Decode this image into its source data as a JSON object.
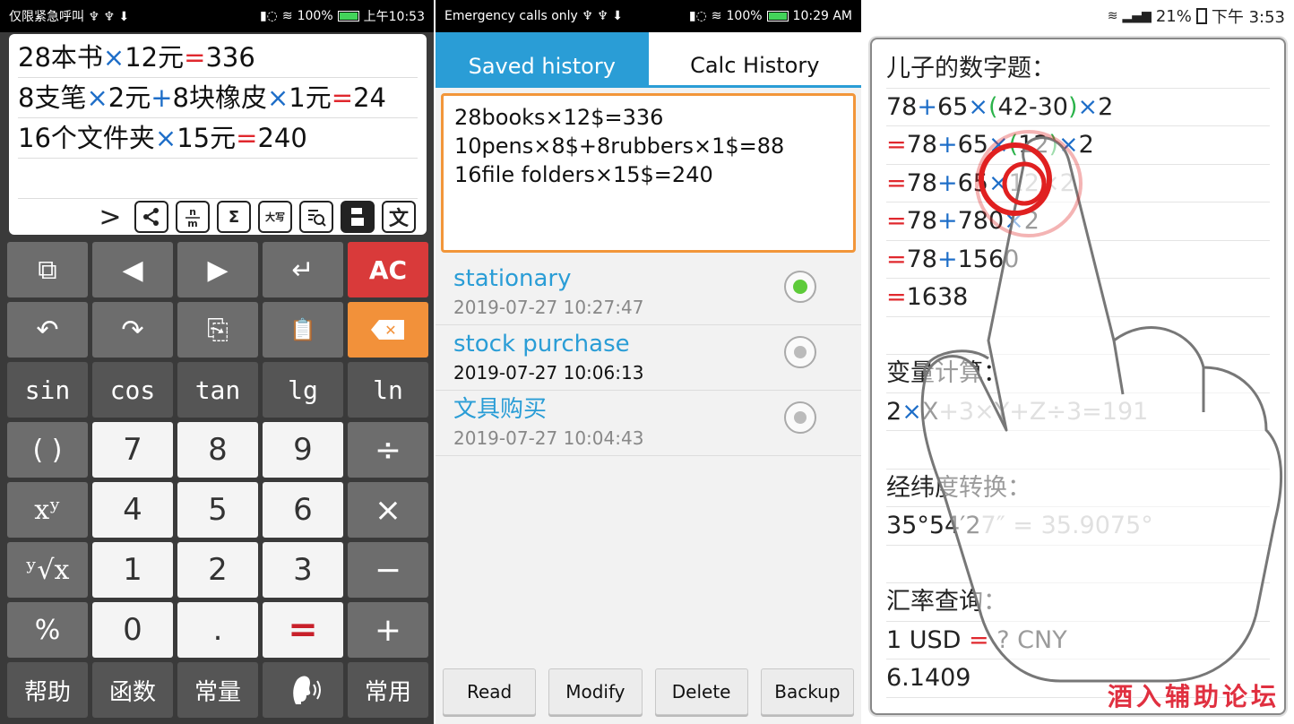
{
  "panel1": {
    "status": {
      "carrier": "仅限紧急呼叫 ♆ ♆ ⬇",
      "battery": "100%",
      "time": "上午10:53"
    },
    "lines": [
      [
        "28本书",
        "×",
        "12元",
        "=",
        "336"
      ],
      [
        "8支笔",
        "×",
        "2元",
        "+",
        "8块橡皮",
        "×",
        "1元",
        "=",
        "24"
      ],
      [
        "16个文件夹",
        "×",
        "15元",
        "=",
        "240"
      ]
    ],
    "tools": {
      "next": ">",
      "share": "share",
      "nm": "n/m",
      "sum": "Σ",
      "daxie": "大写",
      "search": "search",
      "save": "save",
      "wen": "文"
    },
    "keys": {
      "copy_all": "⧉",
      "left": "◀",
      "right": "▶",
      "enter": "↵",
      "ac": "AC",
      "undo": "↶",
      "redo": "↷",
      "copy": "⎘",
      "paste": "📋",
      "backspace": "✕",
      "sin": "sin",
      "cos": "cos",
      "tan": "tan",
      "lg": "lg",
      "ln": "ln",
      "paren": "( )",
      "k7": "7",
      "k8": "8",
      "k9": "9",
      "div": "÷",
      "pow": "xʸ",
      "k4": "4",
      "k5": "5",
      "k6": "6",
      "mul": "×",
      "root": "ʸ√x",
      "k1": "1",
      "k2": "2",
      "k3": "3",
      "minus": "−",
      "pct": "%",
      "k0": "0",
      "dot": ".",
      "eq": "=",
      "plus": "+",
      "help": "帮助",
      "func": "函数",
      "const": "常量",
      "voice": "🔊",
      "common": "常用"
    }
  },
  "panel2": {
    "status": {
      "carrier": "Emergency calls only ♆ ♆ ⬇",
      "battery": "100%",
      "time": "10:29 AM"
    },
    "tab_saved": "Saved history",
    "tab_calc": "Calc History",
    "editor_lines": [
      "28books×12$=336",
      "10pens×8$+8rubbers×1$=88",
      "16file folders×15$=240"
    ],
    "history": [
      {
        "name": "stationary",
        "date": "2019-07-27 10:27:47",
        "selected": true
      },
      {
        "name": "stock purchase",
        "date": "2019-07-27 10:06:13",
        "selected": false
      },
      {
        "name": "文具购买",
        "date": "2019-07-27 10:04:43",
        "selected": false
      }
    ],
    "buttons": {
      "read": "Read",
      "modify": "Modify",
      "delete": "Delete",
      "backup": "Backup"
    }
  },
  "panel3": {
    "status": {
      "battery": "21%",
      "time": "下午 3:53"
    },
    "lines": [
      "儿子的数字题：",
      "78+65×(42-30)×2",
      "=78+65×(12)×2",
      "=78+65×12×2",
      "=78+780×2",
      "=78+1560",
      "=1638",
      "",
      "变量计算：",
      "2×X+3×Y+Z÷3=191",
      "",
      "经纬度转换：",
      "35°54′27″ = 35.9075°",
      "",
      "汇率查询：",
      "1 USD = ? CNY",
      "6.1409"
    ],
    "watermark": "酒入辅助论坛"
  },
  "colors": {
    "accent_blue": "#2a9dd6",
    "orange": "#f2963a",
    "red": "#d93a3a",
    "op_blue": "#1e6ec8",
    "op_red": "#e0282e"
  }
}
